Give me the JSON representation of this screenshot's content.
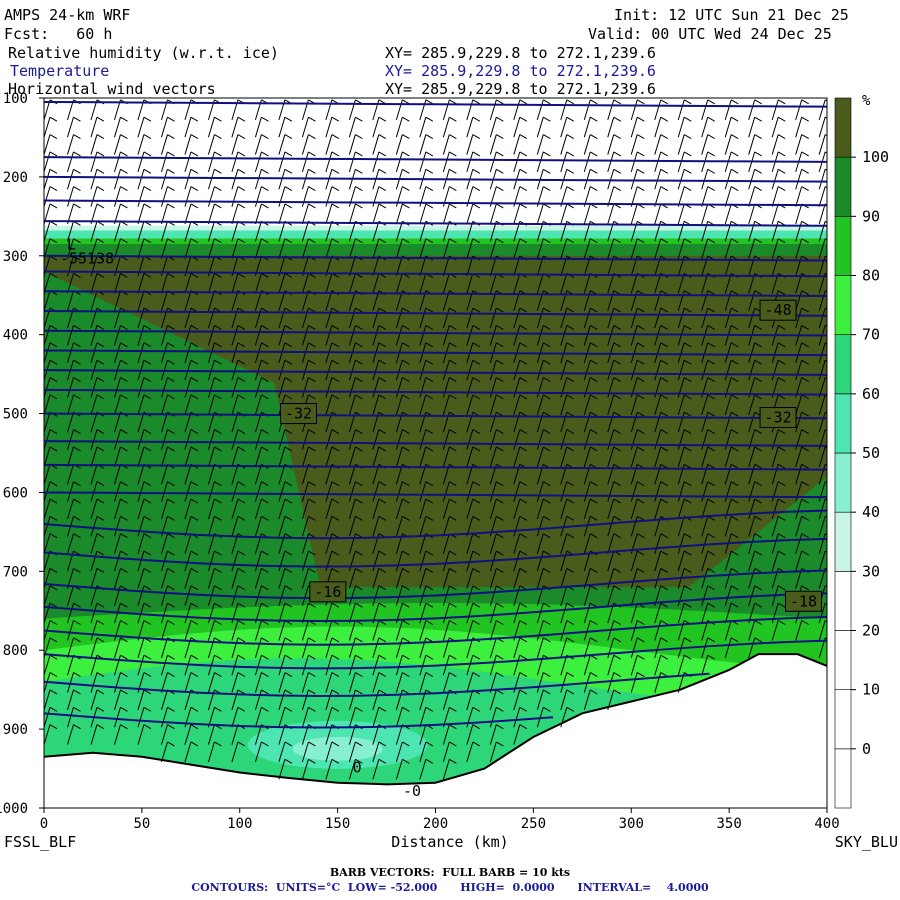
{
  "header": {
    "model": "AMPS 24-km WRF",
    "fcst": "Fcst:   60 h",
    "init": "Init: 12 UTC Sun 21 Dec 25",
    "valid": "Valid: 00 UTC Wed 24 Dec 25",
    "fields": [
      {
        "name": "Relative humidity (w.r.t. ice)",
        "xy": "XY= 285.9,229.8 to 272.1,239.6",
        "color": "#000000"
      },
      {
        "name": "Temperature",
        "xy": "XY= 285.9,229.8 to 272.1,239.6",
        "color": "#1a1a99"
      },
      {
        "name": "Horizontal wind vectors",
        "xy": "XY= 285.9,229.8 to 272.1,239.6",
        "color": "#000000"
      }
    ]
  },
  "footer": {
    "barb": "BARB VECTORS:  FULL BARB = 10 kts",
    "contours": "CONTOURS:  UNITS=°C  LOW= -52.000      HIGH=  0.0000      INTERVAL=    4.0000"
  },
  "chart_data": {
    "type": "heatmap",
    "title": "",
    "xlabel": "Distance (km)",
    "ylabel": "",
    "xlim": [
      0,
      400
    ],
    "ylim": [
      1000,
      100
    ],
    "x_ticks": [
      0,
      50,
      100,
      150,
      200,
      250,
      300,
      350,
      400
    ],
    "y_ticks": [
      100,
      200,
      300,
      400,
      500,
      600,
      700,
      800,
      900,
      1000
    ],
    "start_label": "FSSL_BLF",
    "end_label": "SKY_BLU",
    "colorbar": {
      "unit": "%",
      "ticks": [
        0,
        10,
        20,
        30,
        40,
        50,
        60,
        70,
        80,
        90,
        100
      ],
      "bands": [
        {
          "range": "<0",
          "color": "#ffffff"
        },
        {
          "range": "0-10",
          "color": "#ffffff"
        },
        {
          "range": "10-20",
          "color": "#ffffff"
        },
        {
          "range": "20-30",
          "color": "#ffffff"
        },
        {
          "range": "30-40",
          "color": "#c8f5e6"
        },
        {
          "range": "40-50",
          "color": "#88efd0"
        },
        {
          "range": "50-60",
          "color": "#4de6b3"
        },
        {
          "range": "60-70",
          "color": "#2ed67a"
        },
        {
          "range": "70-80",
          "color": "#3df03d"
        },
        {
          "range": "80-90",
          "color": "#22c422"
        },
        {
          "range": "90-100",
          "color": "#1a8a2a"
        },
        {
          "range": ">100",
          "color": "#4a5c1c"
        }
      ]
    },
    "terrain_profile_hpa": {
      "x": [
        0,
        25,
        50,
        75,
        100,
        125,
        150,
        175,
        200,
        225,
        250,
        275,
        300,
        325,
        350,
        365,
        385,
        400
      ],
      "p": [
        935,
        930,
        935,
        945,
        955,
        962,
        968,
        970,
        968,
        950,
        910,
        880,
        865,
        850,
        825,
        805,
        805,
        820
      ]
    },
    "temperature_contours": [
      {
        "label": "-55",
        "x": [
          0,
          200,
          400
        ],
        "p": [
          300,
          300,
          300
        ]
      },
      {
        "label": "-48",
        "x": [
          0,
          200,
          400
        ],
        "p": [
          370,
          365,
          362
        ]
      },
      {
        "label": "-32",
        "x": [
          0,
          200,
          400
        ],
        "p": [
          498,
          502,
          505
        ]
      },
      {
        "label": "-16",
        "x": [
          0,
          200,
          300,
          400
        ],
        "p": [
          716,
          725,
          740,
          735
        ]
      },
      {
        "label": "-18",
        "x": [
          0,
          200,
          400
        ],
        "p": [
          735,
          745,
          748
        ]
      },
      {
        "label": "0",
        "x": [
          150,
          200
        ],
        "p": [
          960,
          955
        ]
      }
    ],
    "inline_labels": [
      "L",
      "-55138",
      "-48",
      "-32",
      "-32",
      "-16",
      "-18",
      "0",
      "-0"
    ]
  }
}
